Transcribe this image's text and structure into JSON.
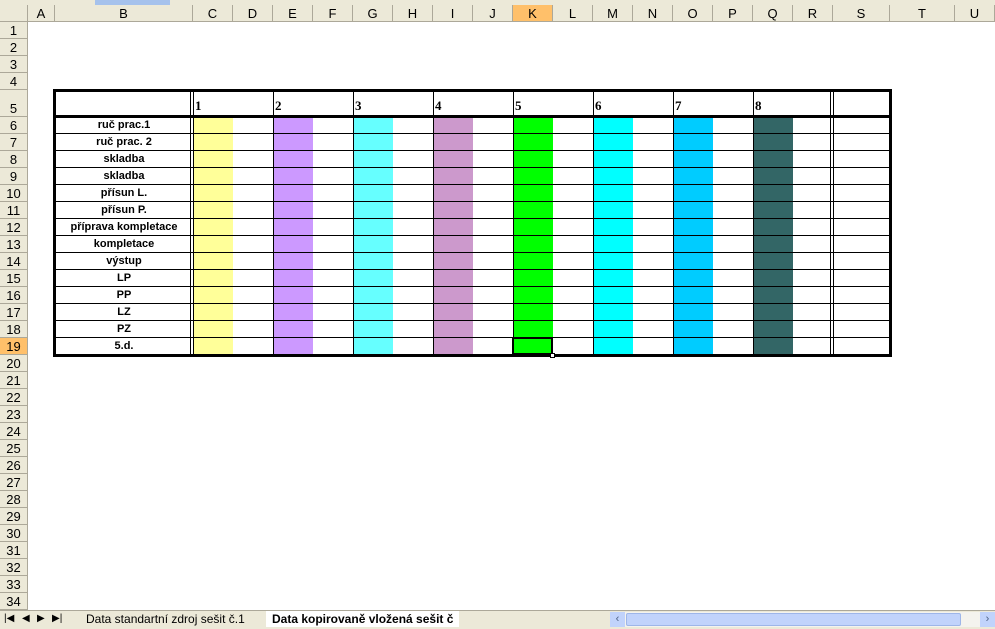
{
  "columns": [
    "A",
    "B",
    "C",
    "D",
    "E",
    "F",
    "G",
    "H",
    "I",
    "J",
    "K",
    "L",
    "M",
    "N",
    "O",
    "P",
    "Q",
    "R",
    "S",
    "T",
    "U"
  ],
  "selected_column": "K",
  "selected_row": "19",
  "row_numbers": [
    "1",
    "2",
    "3",
    "4",
    "5",
    "6",
    "7",
    "8",
    "9",
    "10",
    "11",
    "12",
    "13",
    "14",
    "15",
    "16",
    "17",
    "18",
    "19",
    "20",
    "21",
    "22",
    "23",
    "24",
    "25",
    "26",
    "27",
    "28",
    "29",
    "30",
    "31",
    "32",
    "33",
    "34"
  ],
  "table": {
    "header_numbers": [
      "1",
      "2",
      "3",
      "4",
      "5",
      "6",
      "7",
      "8"
    ],
    "row_labels": [
      "ruč prac.1",
      "ruč prac. 2",
      "skladba",
      "skladba",
      "přísun L.",
      "přísun P.",
      "příprava kompletace",
      "kompletace",
      "výstup",
      "LP",
      "PP",
      "LZ",
      "PZ",
      "5.d."
    ],
    "band_colors": [
      "#FFFF99",
      "#CC99FF",
      "#66FFFF",
      "#CC99CC",
      "#00FF00",
      "#00FFFF",
      "#00CCFF",
      "#336666"
    ]
  },
  "sheet_tabs": [
    {
      "label": "Data standartní zdroj sešit č.1",
      "active": false
    },
    {
      "label": "Data kopirovaně vložená sešit č",
      "active": true
    }
  ]
}
